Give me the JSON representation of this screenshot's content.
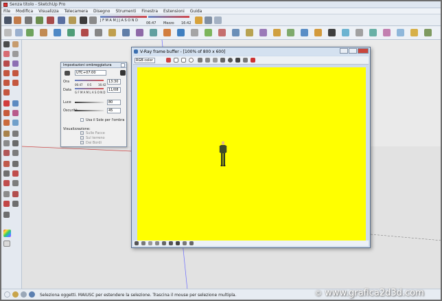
{
  "window": {
    "title": "Senza titolo - SketchUp Pro"
  },
  "menu": {
    "items": [
      "File",
      "Modifica",
      "Visualizza",
      "Telecamera",
      "Disegno",
      "Strumenti",
      "Finestra",
      "Estensioni",
      "Guida"
    ]
  },
  "toolbar_time": {
    "months": "J F M A M J J A S O N D",
    "times": [
      "06:47",
      "Mezzo",
      "16:42"
    ]
  },
  "shadow_panel": {
    "title": "Impostazioni ombreggiatura",
    "timezone": "UTC+07:00",
    "time_label": "Ora",
    "time_scale": [
      "06:47",
      "0:5",
      "16:42"
    ],
    "time_value": "13:30",
    "date_label": "Data",
    "months": "G F M A M L A S O N D",
    "date_value": "11/08",
    "light_label": "Luce",
    "light_value": "80",
    "dark_label": "Oscurità",
    "dark_value": "45",
    "sun_shading_label": "Usa il Sole per l'ombra",
    "display_label": "Visualizzazione:",
    "display_options": [
      "Sulle Facce",
      "Sul terreno",
      "Dai Bordi"
    ]
  },
  "vray": {
    "title": "V-Ray frame buffer - [100% of 800 x 600]",
    "channel": "RGB color"
  },
  "status": {
    "text": "Seleziona oggetti. MAIUSC per estendere la selezione. Trascina il mouse per selezione multipla."
  },
  "watermark": {
    "copyright": "©",
    "text": "www.grafica2d3d.com"
  }
}
